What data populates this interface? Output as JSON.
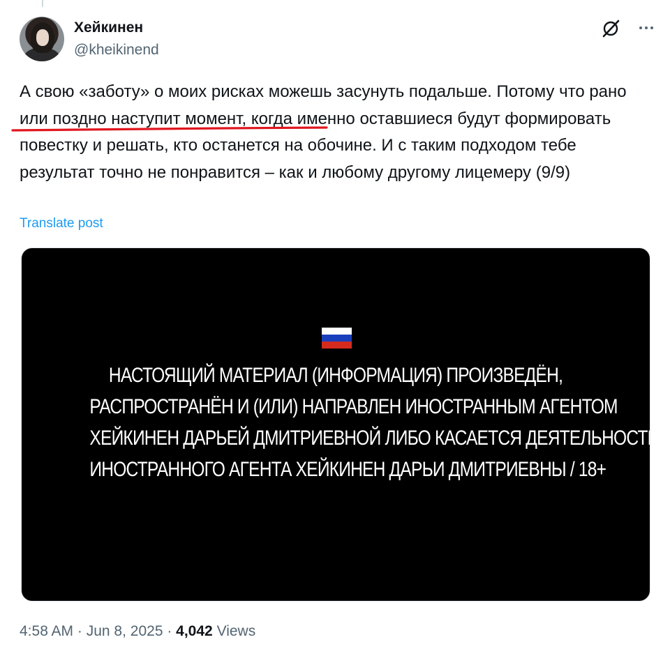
{
  "author": {
    "display_name": "Хейкинен",
    "handle": "@kheikinend"
  },
  "icons": {
    "grok": "grok-icon",
    "more": "more-icon",
    "avatar": "avatar"
  },
  "post": {
    "text": "А свою «заботу» о моих рисках можешь засунуть подальше. Потому что рано или поздно наступит момент, когда именно оставшиеся будут формировать повестку и решать, кто останется на обочине. И с таким подходом тебе результат точно не понравится – как и любому другому лицемеру (9/9)",
    "underlined_phrase": "рано или поздно наступит момент,",
    "translate_label": "Translate post"
  },
  "media": {
    "flag_colors": [
      "#ffffff",
      "#1a3fbd",
      "#d52b1e"
    ],
    "lines": [
      "НАСТОЯЩИЙ МАТЕРИАЛ (ИНФОРМАЦИЯ) ПРОИЗВЕДЁН,",
      "РАСПРОСТРАНЁН И (ИЛИ) НАПРАВЛЕН ИНОСТРАННЫМ АГЕНТОМ",
      "ХЕЙКИНЕН ДАРЬЕЙ ДМИТРИЕВНОЙ ЛИБО КАСАЕТСЯ ДЕЯТЕЛЬНОСТИ",
      "ИНОСТРАННОГО АГЕНТА ХЕЙКИНЕН ДАРЬИ ДМИТРИЕВНЫ / 18+"
    ]
  },
  "footer": {
    "time": "4:58 AM",
    "separator": " · ",
    "date": "Jun 8, 2025",
    "views_count": "4,042",
    "views_label": " Views"
  },
  "colors": {
    "link": "#1d9bf0",
    "secondary_text": "#536471",
    "underline_mark": "#e0161f"
  }
}
